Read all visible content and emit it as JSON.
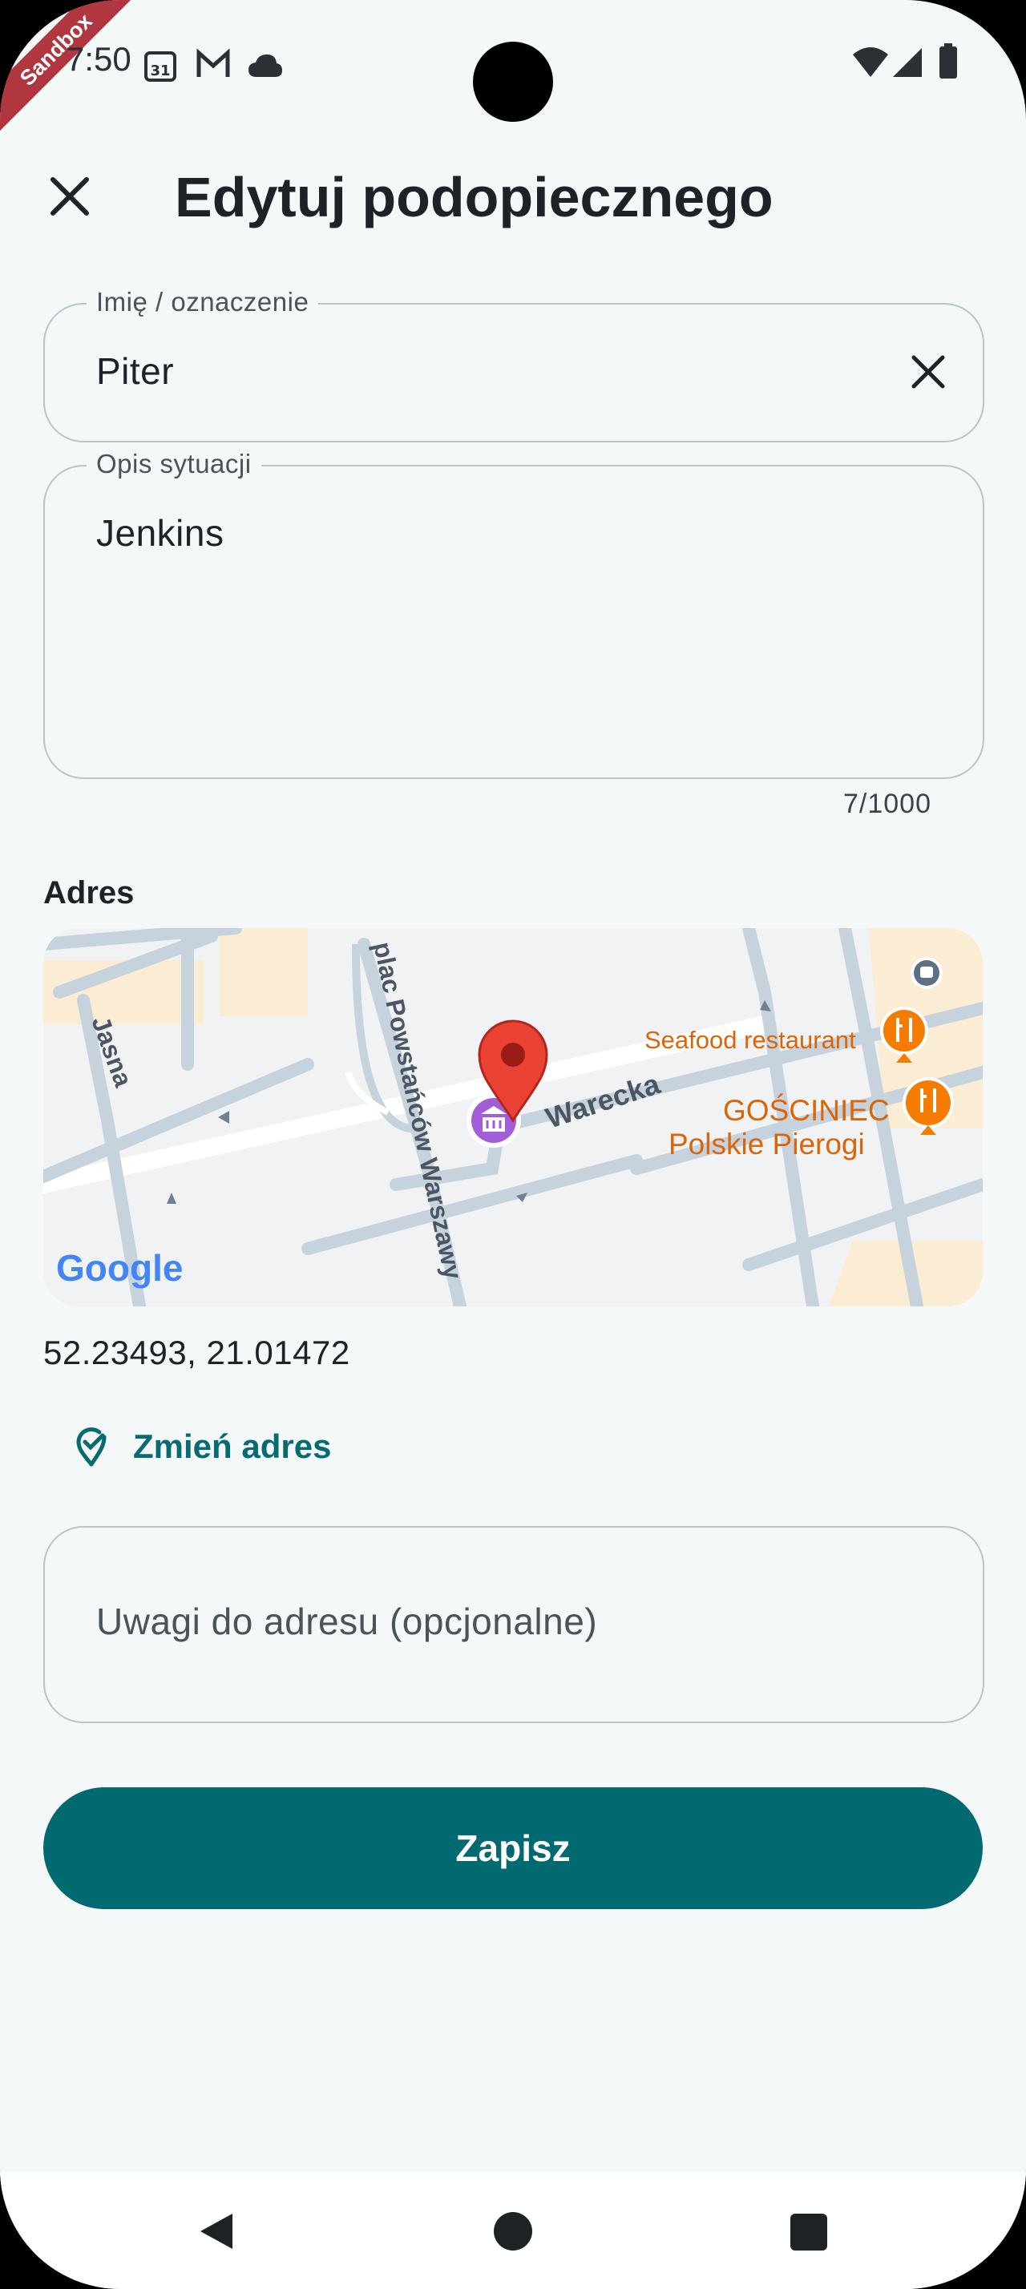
{
  "sandbox_ribbon": "Sandbox",
  "status_bar": {
    "time": "7:50",
    "calendar_day": "31"
  },
  "app_bar": {
    "title": "Edytuj podopiecznego"
  },
  "name_field": {
    "label": "Imię / oznaczenie",
    "value": "Piter"
  },
  "description_field": {
    "label": "Opis sytuacji",
    "value": "Jenkins",
    "counter": "7/1000"
  },
  "address": {
    "section_title": "Adres",
    "map": {
      "streets": [
        "Jasna",
        "plac Powstańców Warszawy",
        "Warecka"
      ],
      "places": [
        "Seafood restaurant",
        "GOŚCINIEC",
        "Polskie Pierogi"
      ],
      "attribution": "Google"
    },
    "coordinates": "52.23493, 21.01472",
    "change_label": "Zmień adres"
  },
  "notes_field": {
    "placeholder": "Uwagi do adresu (opcjonalne)"
  },
  "save_button": {
    "label": "Zapisz"
  },
  "colors": {
    "accent": "#016970",
    "link": "#076b72",
    "background": "#f4f8f9",
    "pin": "#ea4335",
    "poi": "#f57c00"
  }
}
